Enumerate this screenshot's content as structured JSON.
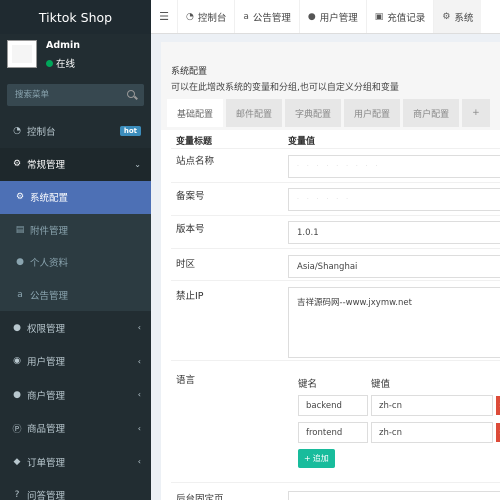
{
  "app": {
    "title": "Tiktok Shop"
  },
  "user": {
    "name": "Admin",
    "status": "在线"
  },
  "search": {
    "placeholder": "搜索菜单"
  },
  "sidebar": {
    "items": [
      {
        "label": "控制台",
        "icon": "dashboard-icon",
        "badge": "hot"
      },
      {
        "label": "常规管理",
        "icon": "cogs-icon"
      },
      {
        "label": "系统配置",
        "icon": "gear-icon"
      },
      {
        "label": "附件管理",
        "icon": "file-image-icon"
      },
      {
        "label": "个人资料",
        "icon": "user-icon"
      },
      {
        "label": "公告管理",
        "icon": "amazon-icon"
      },
      {
        "label": "权限管理",
        "icon": "group-icon"
      },
      {
        "label": "用户管理",
        "icon": "user-circle-icon"
      },
      {
        "label": "商户管理",
        "icon": "apple-icon"
      },
      {
        "label": "商品管理",
        "icon": "product-hunt-icon"
      },
      {
        "label": "订单管理",
        "icon": "cube-icon"
      },
      {
        "label": "问答管理",
        "icon": "question-icon"
      }
    ]
  },
  "navbar": {
    "tabs": [
      {
        "label": "控制台",
        "icon": "dashboard-icon"
      },
      {
        "label": "公告管理",
        "icon": "amazon-icon"
      },
      {
        "label": "用户管理",
        "icon": "user-icon"
      },
      {
        "label": "充值记录",
        "icon": "money-icon"
      },
      {
        "label": "系统",
        "icon": "gear-icon"
      }
    ]
  },
  "config": {
    "title": "系统配置",
    "description": "可以在此增改系统的变量和分组,也可以自定义分组和变量",
    "tabs": [
      "基础配置",
      "邮件配置",
      "字典配置",
      "用户配置",
      "商户配置",
      "+"
    ],
    "headers": {
      "title": "变量标题",
      "value": "变量值"
    },
    "rows": [
      {
        "label": "站点名称",
        "value": ""
      },
      {
        "label": "备案号",
        "value": ""
      },
      {
        "label": "版本号",
        "value": "1.0.1"
      },
      {
        "label": "时区",
        "value": "Asia/Shanghai"
      },
      {
        "label": "禁止IP",
        "value": "吉祥源码网--www.jxymw.net"
      },
      {
        "label": "语言",
        "value": ""
      },
      {
        "label": "后台固定页",
        "value": ""
      }
    ],
    "language": {
      "key_header": "键名",
      "value_header": "键值",
      "pairs": [
        {
          "key": "backend",
          "value": "zh-cn"
        },
        {
          "key": "frontend",
          "value": "zh-cn"
        }
      ],
      "add_label": "追加"
    }
  },
  "colors": {
    "sidebar_bg": "#222d32",
    "active_item": "#4d70b5",
    "hot_badge": "#3c8dbc",
    "add_button": "#18bc9c",
    "delete_button": "#dd4b39"
  }
}
